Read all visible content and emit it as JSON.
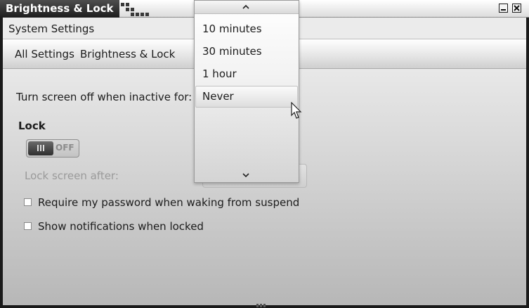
{
  "window": {
    "title": "Brightness & Lock"
  },
  "menubar": {
    "app_menu": "System Settings"
  },
  "breadcrumb": {
    "items": [
      "All Settings",
      "Brightness & Lock"
    ]
  },
  "screen_off": {
    "label": "Turn screen off when inactive for:"
  },
  "lock": {
    "heading": "Lock",
    "switch_state": "OFF",
    "lock_after_label": "Lock screen after:"
  },
  "checkboxes": [
    {
      "label": "Require my password when waking from suspend",
      "checked": false
    },
    {
      "label": "Show notifications when locked",
      "checked": false
    }
  ],
  "dropdown": {
    "options": [
      "10 minutes",
      "30 minutes",
      "1 hour",
      "Never"
    ],
    "highlighted": "Never",
    "scroll_up_icon": "chevron-up-icon",
    "scroll_down_icon": "chevron-down-icon"
  },
  "colors": {
    "title_tab": "#2c2c2c",
    "window_background": "#d6d6d6",
    "disabled_text": "#9a9a9a"
  }
}
